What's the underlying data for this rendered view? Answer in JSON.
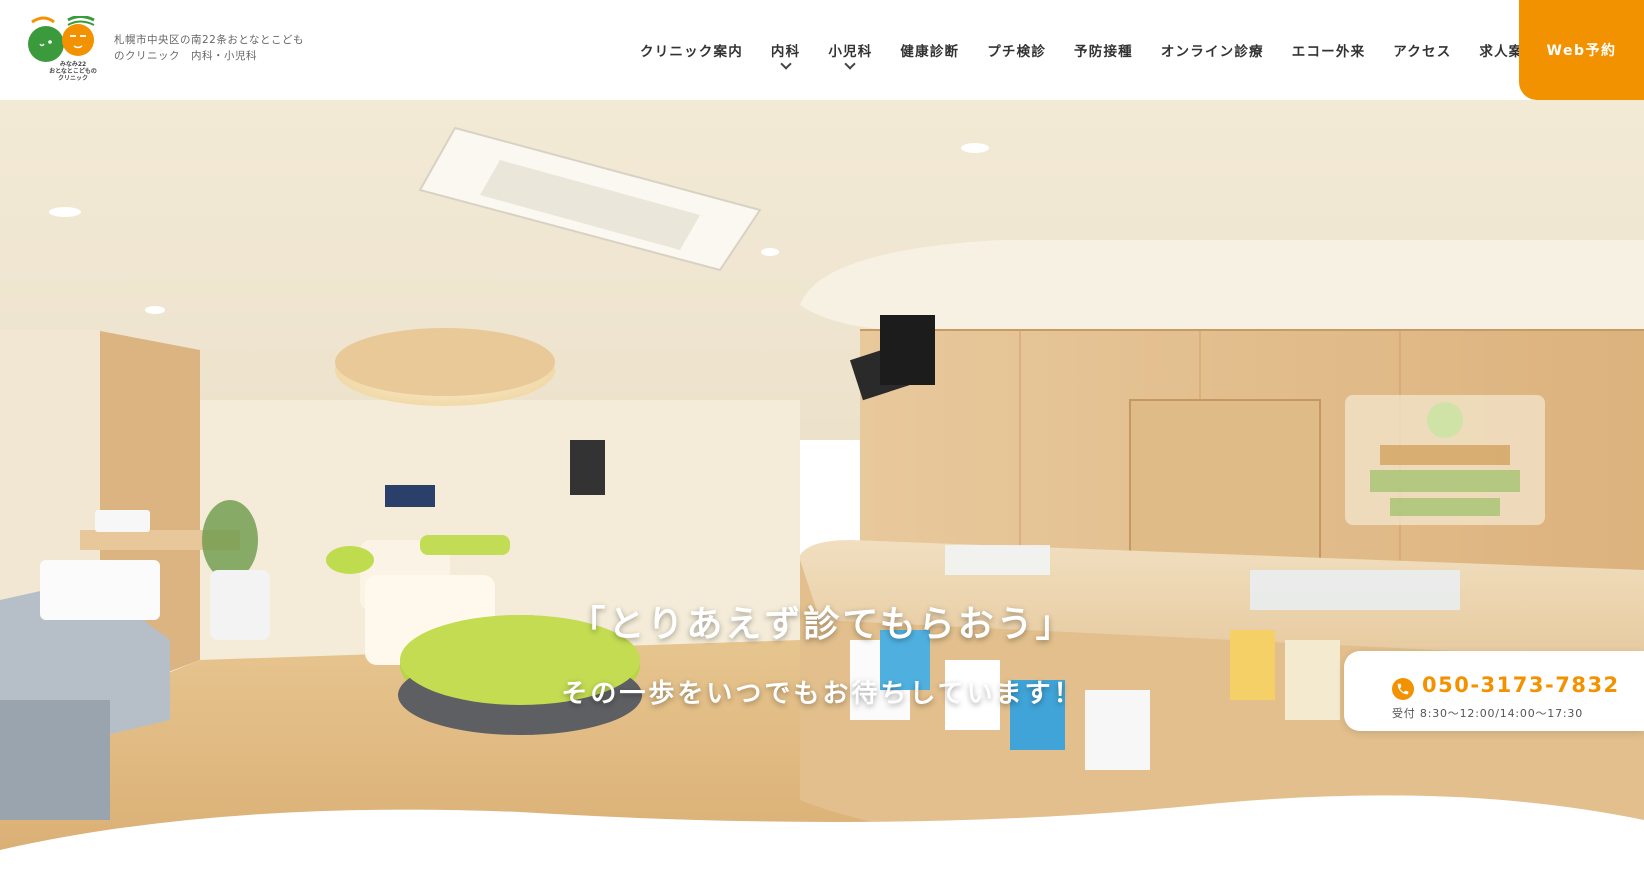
{
  "header": {
    "logo_caption": [
      "みなみ22",
      "おとなとこどもの",
      "クリニック"
    ],
    "tagline": [
      "札幌市中央区の南22条おとなとこども",
      "のクリニック　内科・小児科"
    ],
    "nav": [
      {
        "label": "クリニック案内",
        "has_dropdown": false
      },
      {
        "label": "内科",
        "has_dropdown": true
      },
      {
        "label": "小児科",
        "has_dropdown": true
      },
      {
        "label": "健康診断",
        "has_dropdown": false
      },
      {
        "label": "プチ検診",
        "has_dropdown": false
      },
      {
        "label": "予防接種",
        "has_dropdown": false
      },
      {
        "label": "オンライン診療",
        "has_dropdown": false
      },
      {
        "label": "エコー外来",
        "has_dropdown": false
      },
      {
        "label": "アクセス",
        "has_dropdown": false
      },
      {
        "label": "求人案内",
        "has_dropdown": false
      }
    ],
    "web_button": "Web予約"
  },
  "hero": {
    "catch_main": "「とりあえず診てもらおう」",
    "catch_sub": "その一歩をいつでもお待ちしています！"
  },
  "phone": {
    "number": "050-3173-7832",
    "hours": "受付 8:30〜12:00/14:00〜17:30",
    "icon": "phone-icon"
  },
  "colors": {
    "accent": "#f39200",
    "logo_green": "#3a9a3c",
    "logo_orange": "#f39200"
  }
}
